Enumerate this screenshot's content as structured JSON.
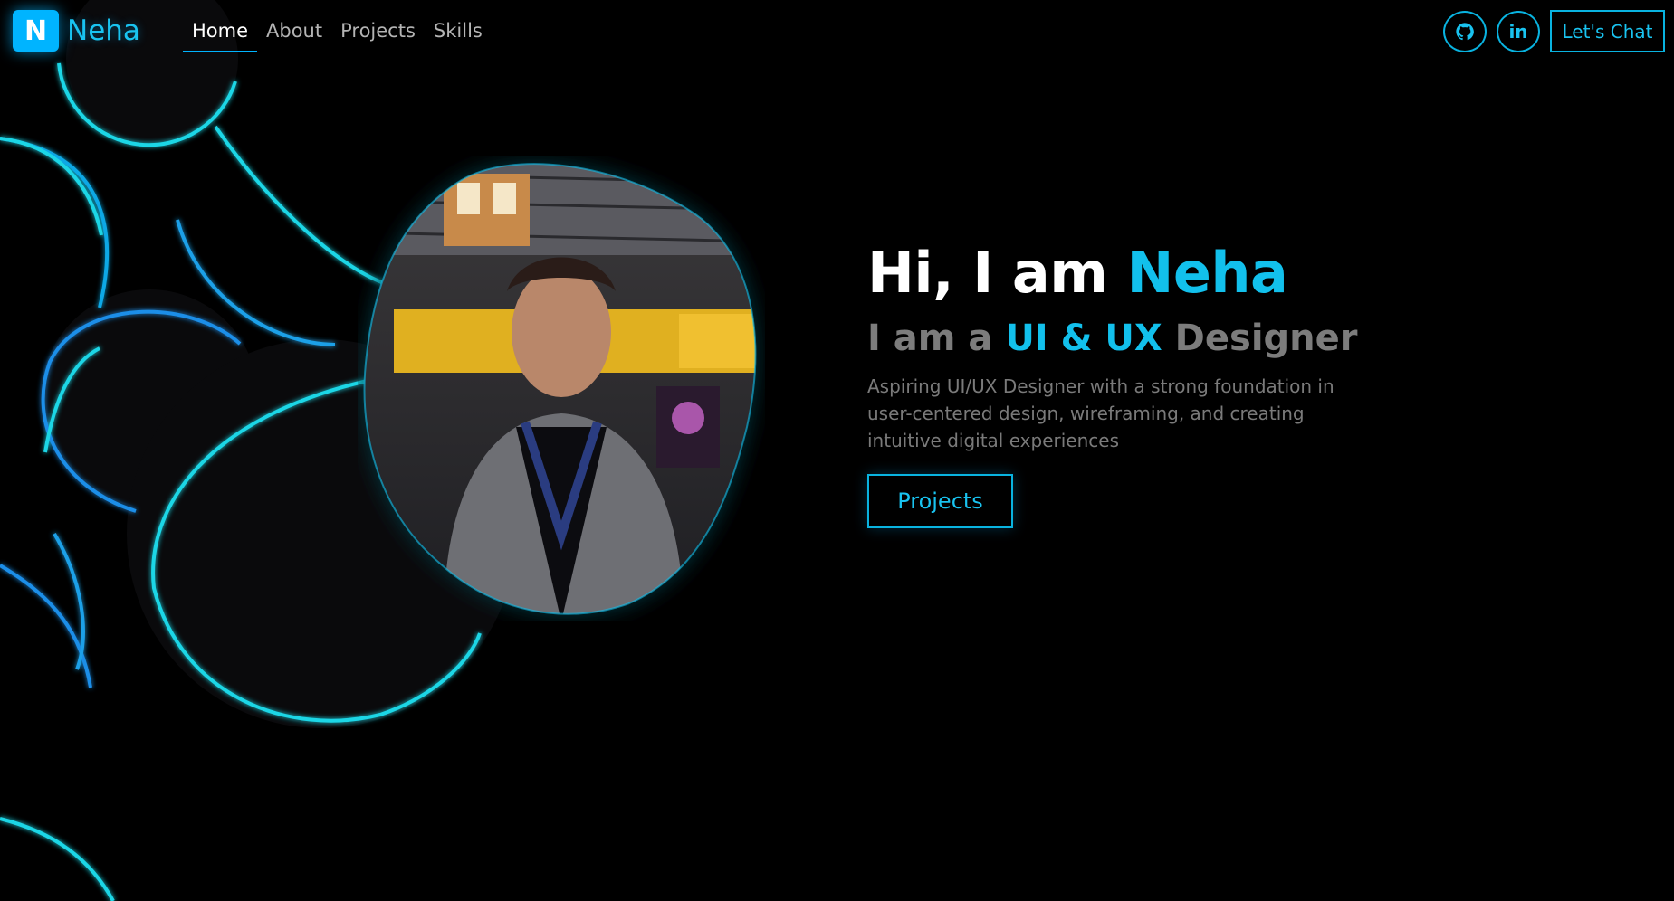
{
  "logo": {
    "mark": "N",
    "text": "Neha"
  },
  "nav": {
    "links": [
      {
        "label": "Home",
        "active": true
      },
      {
        "label": "About",
        "active": false
      },
      {
        "label": "Projects",
        "active": false
      },
      {
        "label": "Skills",
        "active": false
      }
    ]
  },
  "social": {
    "github_icon": "github-icon",
    "linkedin_icon": "linkedin-icon",
    "linkedin_glyph": "in",
    "chat_label": "Let's Chat"
  },
  "hero": {
    "greeting_prefix": "Hi, I am ",
    "name": "Neha",
    "role_prefix": "I am a ",
    "role_highlight": "UI & UX",
    "role_suffix": " Designer",
    "description": "Aspiring UI/UX Designer with a strong foundation in user-centered design, wireframing, and creating intuitive digital experiences",
    "cta_label": "Projects"
  },
  "colors": {
    "accent": "#12c0ec",
    "background": "#000000",
    "muted_text": "#7a7a7a"
  }
}
